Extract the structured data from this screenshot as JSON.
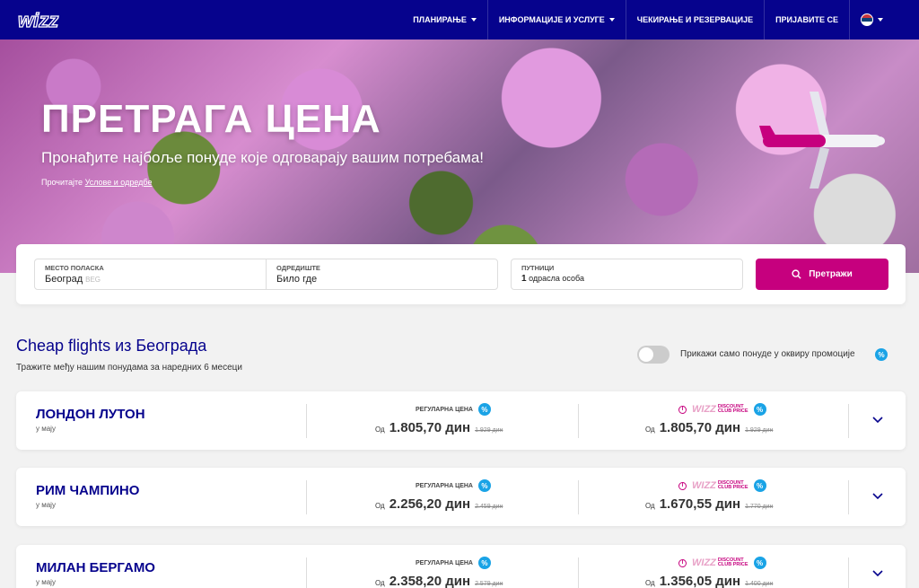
{
  "header": {
    "logo_alt": "wizz",
    "nav": [
      {
        "label": "ПЛАНИРАЊЕ",
        "dropdown": true
      },
      {
        "label": "ИНФОРМАЦИЈЕ И УСЛУГЕ",
        "dropdown": true
      },
      {
        "label": "ЧЕКИРАЊЕ И РЕЗЕРВАЦИЈЕ",
        "dropdown": false
      },
      {
        "label": "ПРИЈАВИТЕ СЕ",
        "dropdown": false
      }
    ]
  },
  "hero": {
    "title": "ПРЕТРАГА ЦЕНА",
    "subtitle": "Пронађите најбоље понуде које одговарају вашим потребама!",
    "terms_prefix": "Прочитајте",
    "terms_link": "Услове и одредбе"
  },
  "search": {
    "origin_label": "МЕСТО ПОЛАСКА",
    "origin_value": "Београд",
    "origin_code": "BEG",
    "destination_label": "ОДРЕДИШТЕ",
    "destination_value": "Било где",
    "passengers_label": "ПУТНИЦИ",
    "passengers_count": "1",
    "passengers_text": "одрасла особа",
    "search_button": "Претражи"
  },
  "section": {
    "title": "Cheap flights из Београда",
    "subtitle": "Тражите међу нашим понудама за наредних 6 месеци",
    "toggle_label": "Прикажи само понуде у оквиру промоције",
    "percent_symbol": "%"
  },
  "labels": {
    "regular": "РЕГУЛАРНА ЦЕНА",
    "from": "Од",
    "club_top": "DISCOUNT",
    "club_bottom": "CLUB PRICE",
    "club_brand": "wizz",
    "info": "i"
  },
  "flights": [
    {
      "destination": "ЛОНДОН ЛУТОН",
      "when": "у мају",
      "regular_price": "1.805,70 дин",
      "regular_old": "1.929 дин",
      "club_price": "1.805,70 дин",
      "club_old": "1.929 дин"
    },
    {
      "destination": "РИМ ЧАМПИНО",
      "when": "у мају",
      "regular_price": "2.256,20 дин",
      "regular_old": "2.459 дин",
      "club_price": "1.670,55 дин",
      "club_old": "1.770 дин"
    },
    {
      "destination": "МИЛАН БЕРГАМО",
      "when": "у мају",
      "regular_price": "2.358,20 дин",
      "regular_old": "2.579 дин",
      "club_price": "1.356,05 дин",
      "club_old": "1.400 дин"
    }
  ],
  "colors": {
    "brand_navy": "#06038d",
    "brand_magenta": "#c6007e",
    "badge_blue": "#1aa3e6"
  }
}
